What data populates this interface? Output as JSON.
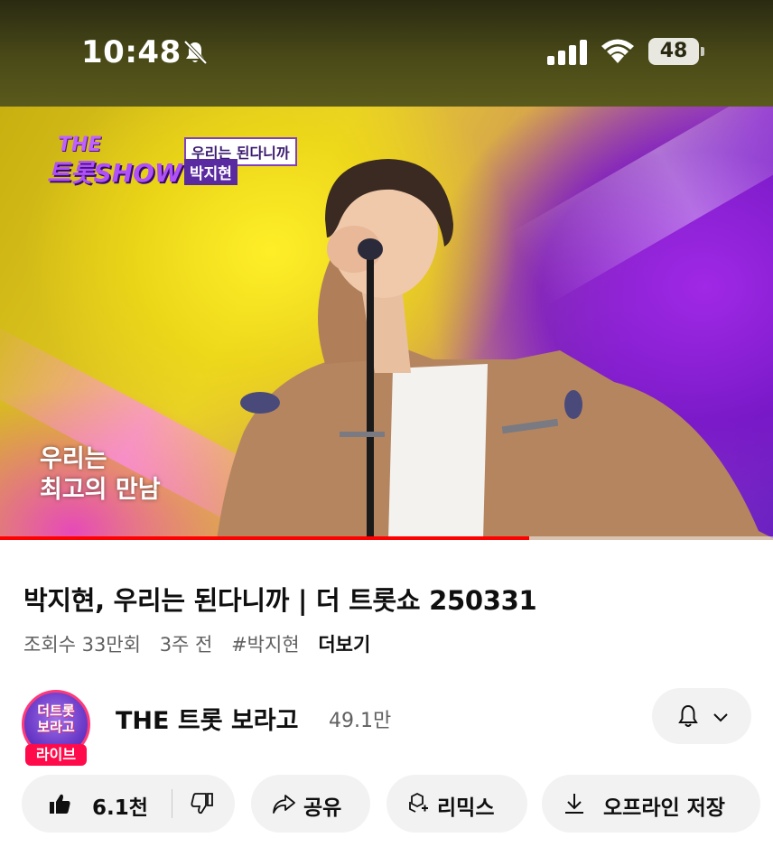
{
  "status_bar": {
    "time": "10:48",
    "battery": "48",
    "icons": [
      "bell-slash-icon",
      "signal-icon",
      "wifi-icon",
      "battery-icon"
    ]
  },
  "video": {
    "show_logo_the": "THE",
    "show_logo_main": "트롯SHOW",
    "song_tag": "우리는 된다니까",
    "artist_tag": "박지현",
    "lyrics": [
      "우리는",
      "최고의 만남"
    ],
    "progress": 0.685,
    "progress_color": "#ff0000"
  },
  "details": {
    "title": "박지현, 우리는 된다니까 | 더 트롯쇼 250331",
    "views": "조회수 33만회",
    "age": "3주 전",
    "hashtag": "#박지현",
    "more": "더보기"
  },
  "channel": {
    "avatar_text_line1": "더트롯",
    "avatar_text_line2": "보라고",
    "live_badge": "라이브",
    "name": "THE 트롯 보라고",
    "subscribers": "49.1만",
    "accent": "#ff0a4a"
  },
  "actions": {
    "like_count": "6.1천",
    "share": "공유",
    "remix": "리믹스",
    "offline_save": "오프라인 저장"
  }
}
